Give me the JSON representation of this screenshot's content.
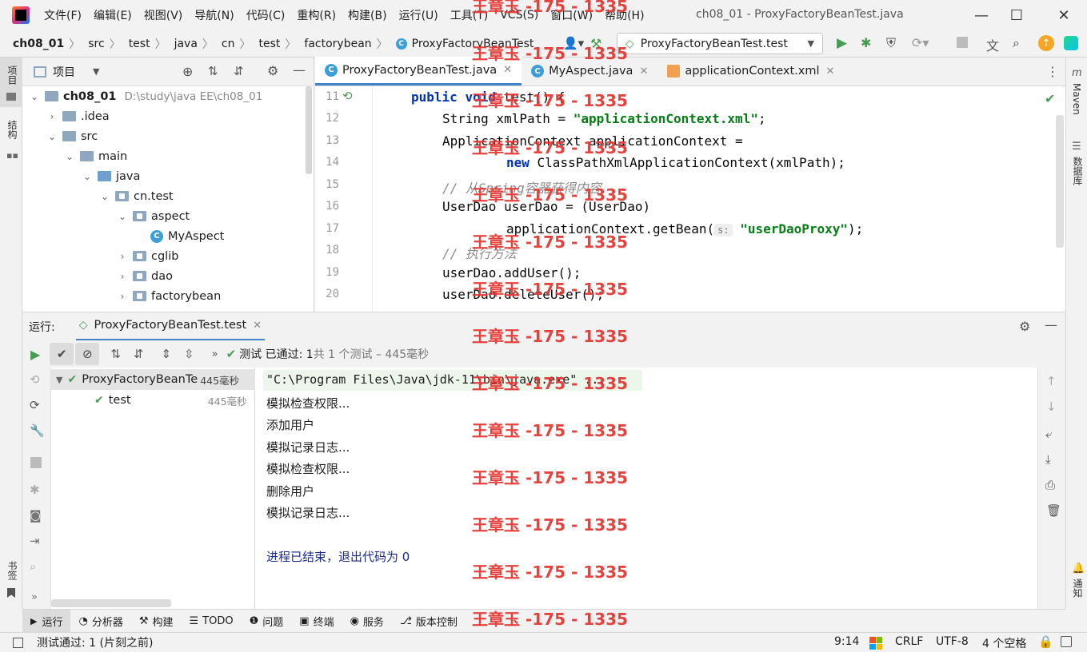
{
  "window": {
    "title": "ch08_01 - ProxyFactoryBeanTest.java",
    "minimize": "—",
    "maximize": "☐",
    "close": "✕"
  },
  "menu": [
    "文件(F)",
    "编辑(E)",
    "视图(V)",
    "导航(N)",
    "代码(C)",
    "重构(R)",
    "构建(B)",
    "运行(U)",
    "工具(T)",
    "VCS(S)",
    "窗口(W)",
    "帮助(H)"
  ],
  "breadcrumb": [
    "ch08_01",
    "src",
    "test",
    "java",
    "cn",
    "test",
    "factorybean",
    "ProxyFactoryBeanTest"
  ],
  "run_config": "ProxyFactoryBeanTest.test",
  "left_strip": {
    "project": "项目",
    "structure": "结构",
    "bookmarks": "书签"
  },
  "right_strip": {
    "maven": "Maven",
    "database": "数据库",
    "notifications": "通知"
  },
  "project_panel": {
    "title": "项目",
    "tree": [
      {
        "label": "ch08_01",
        "path": "D:\\study\\java EE\\ch08_01"
      },
      {
        "label": ".idea"
      },
      {
        "label": "src"
      },
      {
        "label": "main"
      },
      {
        "label": "java"
      },
      {
        "label": "cn.test"
      },
      {
        "label": "aspect"
      },
      {
        "label": "MyAspect"
      },
      {
        "label": "cglib"
      },
      {
        "label": "dao"
      },
      {
        "label": "factorybean"
      }
    ]
  },
  "editor_tabs": [
    {
      "label": "ProxyFactoryBeanTest.java"
    },
    {
      "label": "MyAspect.java"
    },
    {
      "label": "applicationContext.xml"
    }
  ],
  "code": {
    "line_numbers": [
      "11",
      "12",
      "13",
      "14",
      "15",
      "16",
      "17",
      "18",
      "19",
      "20"
    ],
    "l11_kw1": "public",
    "l11_kw2": "void",
    "l11_rest": " test() {",
    "l12_a": "String xmlPath = ",
    "l12_s": "\"applicationContext.xml\"",
    "l12_b": ";",
    "l13": "ApplicationContext applicationContext =",
    "l14_kw": "new",
    "l14_rest": " ClassPathXmlApplicationContext(xmlPath);",
    "l15": "// 从Spring容器获得内容",
    "l16": "UserDao userDao = (UserDao)",
    "l17_a": "applicationContext.getBean(",
    "l17_hint": "s:",
    "l17_s": "\"userDaoProxy\"",
    "l17_b": ");",
    "l18": "// 执行方法",
    "l19": "userDao.addUser();",
    "l20": "userDao.deleteUser();"
  },
  "run_panel": {
    "label": "运行:",
    "tab": "ProxyFactoryBeanTest.test",
    "status_prefix": "测试 已通过: ",
    "status_count": "1",
    "status_rest": "共 1 个测试 – 445毫秒",
    "tree": [
      {
        "label": "ProxyFactoryBeanTe",
        "time": "445毫秒"
      },
      {
        "label": "test",
        "time": "445毫秒"
      }
    ],
    "console": [
      "\"C:\\Program Files\\Java\\jdk-11\\bin\\java.exe\" ...",
      "模拟检查权限...",
      "添加用户",
      "模拟记录日志...",
      "模拟检查权限...",
      "删除用户",
      "模拟记录日志...",
      "",
      "进程已结束，退出代码为 0"
    ]
  },
  "bottom_tabs": [
    "运行",
    "分析器",
    "构建",
    "TODO",
    "问题",
    "终端",
    "服务",
    "版本控制"
  ],
  "status_bar": {
    "message": "测试通过: 1 (片刻之前)",
    "position": "9:14",
    "line_sep": "CRLF",
    "encoding": "UTF-8",
    "indent": "4 个空格"
  },
  "watermark": "王章玉 -175 - 1335"
}
